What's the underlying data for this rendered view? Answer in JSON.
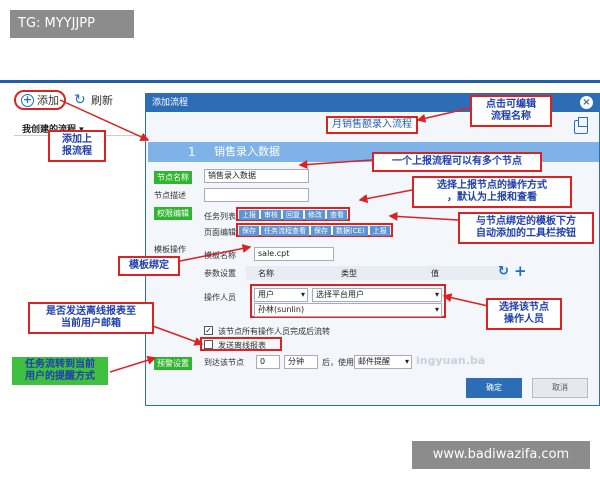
{
  "tags": {
    "tg": "TG: MYYJJPP",
    "site": "www.badiwazifa.com"
  },
  "app": {
    "add_label": "添加",
    "refresh_label": "刷新",
    "my_flows_label": "我创建的流程 ▾"
  },
  "dialog": {
    "title": "添加流程",
    "flow_name": "月销售额录入流程",
    "node_number": "1",
    "node_name": "销售录入数据",
    "labels": {
      "node_name": "节点名称",
      "node_desc": "节点描述",
      "permission": "权限编辑",
      "task_list": "任务列表",
      "page_edit": "页面编辑",
      "template_ops": "模板操作",
      "template_name": "模板名称",
      "param_settings": "参数设置",
      "operators": "操作人员",
      "warn_settings": "预警设置",
      "arrive_node": "到达该节点"
    },
    "node_name_value": "销售录入数据",
    "task_buttons": [
      "上报",
      "审核",
      "回复",
      "修改",
      "查看"
    ],
    "page_buttons": [
      "保存",
      "任务流程查看",
      "保存",
      "数据(CE)",
      "上报"
    ],
    "template_name_value": "sale.cpt",
    "grid_headers": [
      "名称",
      "类型",
      "值"
    ],
    "operator_type": "用户",
    "operator_scope": "选择平台用户",
    "operator_user": "孙林(sunlin)",
    "check_all_complete": "该节点所有操作人员完成后流转",
    "check_offline_report": "发送离线报表",
    "warn_value": "0",
    "warn_unit": "分钟",
    "warn_after": "后，使用",
    "warn_method": "邮件提醒",
    "brand_watermark": "ingyuan.ba",
    "ok_label": "确定",
    "cancel_label": "取消"
  },
  "annotations": {
    "add_flow": "添加上\n报流程",
    "edit_name": "点击可编辑\n流程名称",
    "multi_nodes": "一个上报流程可以有多个节点",
    "operations": "选择上报节点的操作方式\n，默认为上报和查看",
    "toolbar_buttons": "与节点绑定的模板下方\n自动添加的工具栏按钮",
    "template_bind": "模板绑定",
    "select_operators": "选择该节点\n操作人员",
    "send_offline": "是否发送离线报表至\n当前用户邮箱",
    "reminder": "任务流转到当前\n用户的提醒方式"
  }
}
